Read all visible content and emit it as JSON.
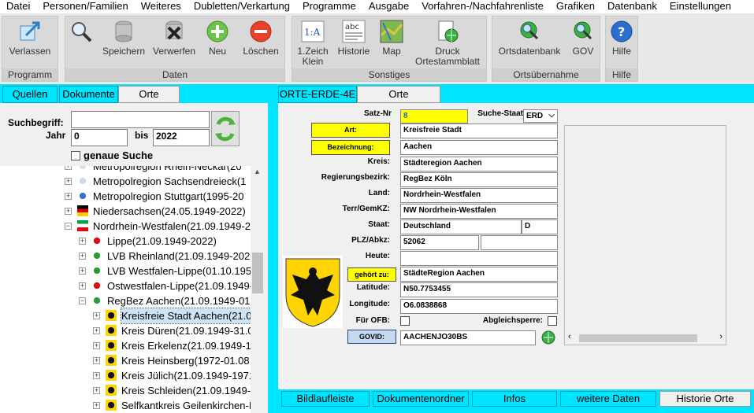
{
  "menu": [
    "Datei",
    "Personen/Familien",
    "Weiteres",
    "Dubletten/Verkartung",
    "Programme",
    "Ausgabe",
    "Vorfahren-/Nachfahrenliste",
    "Grafiken",
    "Datenbank",
    "Einstellungen"
  ],
  "ribbon": {
    "groups": {
      "programm": "Programm",
      "daten": "Daten",
      "sonstiges": "Sonstiges",
      "ortsuebernahme": "Ortsübernahme",
      "hilfe": "Hilfe"
    },
    "buttons": {
      "verlassen": "Verlassen",
      "speichern": "Speichern",
      "verwerfen": "Verwerfen",
      "neu": "Neu",
      "loeschen": "Löschen",
      "zeich1": "1.Zeich",
      "zeich2": "Klein",
      "historie": "Historie",
      "map": "Map",
      "druck1": "Druck",
      "druck2": "Ortestammblatt",
      "ortsdatenbank": "Ortsdatenbank",
      "gov": "GOV",
      "hilfe": "Hilfe"
    }
  },
  "left_tabs": [
    "Quellen",
    "Dokumente",
    "Orte"
  ],
  "search": {
    "label": "Suchbegriff:",
    "value": "",
    "jahr_label": "Jahr",
    "jahr_from": "0",
    "bis_label": "bis",
    "jahr_to": "2022",
    "exact_label": "genaue Suche"
  },
  "tree": [
    {
      "text": "Metropolregion Rhein-Neckar(20",
      "indent": 0,
      "plus": "+"
    },
    {
      "text": "Metropolregion Sachsendreieck(1",
      "indent": 0,
      "plus": "+"
    },
    {
      "text": "Metropolregion Stuttgart(1995-20",
      "indent": 0,
      "plus": "+"
    },
    {
      "text": "Niedersachsen(24.05.1949-2022)",
      "indent": 0,
      "plus": "+"
    },
    {
      "text": "Nordrhein-Westfalen(21.09.1949-2",
      "indent": 0,
      "plus": "−"
    },
    {
      "text": "Lippe(21.09.1949-2022)",
      "indent": 1,
      "plus": "+"
    },
    {
      "text": "LVB Rheinland(21.09.1949-2022",
      "indent": 1,
      "plus": "+"
    },
    {
      "text": "LVB Westfalen-Lippe(01.10.195:",
      "indent": 1,
      "plus": "+"
    },
    {
      "text": "Ostwestfalen-Lippe(21.09.1949-",
      "indent": 1,
      "plus": "+"
    },
    {
      "text": "RegBez Aachen(21.09.1949-01.(",
      "indent": 1,
      "plus": "−"
    },
    {
      "text": "Kreisfreie Stadt Aachen(21.0",
      "indent": 2,
      "plus": "+",
      "selected": true
    },
    {
      "text": "Kreis Düren(21.09.1949-31.0",
      "indent": 2,
      "plus": "+"
    },
    {
      "text": "Kreis Erkelenz(21.09.1949-1!",
      "indent": 2,
      "plus": "+"
    },
    {
      "text": "Kreis Heinsberg(1972-01.08",
      "indent": 2,
      "plus": "+"
    },
    {
      "text": "Kreis Jülich(21.09.1949-1971",
      "indent": 2,
      "plus": "+"
    },
    {
      "text": "Kreis Schleiden(21.09.1949-'",
      "indent": 2,
      "plus": "+"
    },
    {
      "text": "Selfkantkreis Geilenkirchen-I",
      "indent": 2,
      "plus": "+"
    }
  ],
  "right_tabs": [
    "ORTE-ERDE-4E",
    "Orte"
  ],
  "form": {
    "satznr_label": "Satz-Nr",
    "satznr": "8",
    "suche_staat_label": "Suche-Staat",
    "suche_staat": "ERD",
    "art_label": "Art:",
    "art": "Kreisfreie Stadt",
    "bez_label": "Bezeichnung:",
    "bez": "Aachen",
    "kreis_label": "Kreis:",
    "kreis": "Städteregion Aachen",
    "regbez_label": "Regierungsbezirk:",
    "regbez": "RegBez Köln",
    "land_label": "Land:",
    "land": "Nordrhein-Westfalen",
    "terr_label": "Terr/GemKZ:",
    "terr": "NW  Nordrhein-Westfalen",
    "staat_label": "Staat:",
    "staat": "Deutschland",
    "staat_code": "D",
    "plz_label": "PLZ/Abkz:",
    "plz": "52062",
    "plz2": "",
    "heute_label": "Heute:",
    "heute": "",
    "gehoert_label": "gehört zu:",
    "gehoert": "StädteRegion Aachen",
    "lat_label": "Latitude:",
    "lat": "N50.7753455",
    "lon_label": "Longitude:",
    "lon": "O6.0838868",
    "ofb_label": "Für OFB:",
    "abgleich_label": "Abgleichsperre:",
    "govid_label": "GOVID:",
    "govid": "AACHENJO30BS"
  },
  "bottom_tabs": [
    "Bildlaufleiste",
    "Dokumentenordner",
    "Infos",
    "weitere Daten",
    "Historie Orte"
  ],
  "colors": {
    "cyan": "#00e5ff",
    "yellow": "#ffff00",
    "govid_btn": "#c5daf0"
  }
}
